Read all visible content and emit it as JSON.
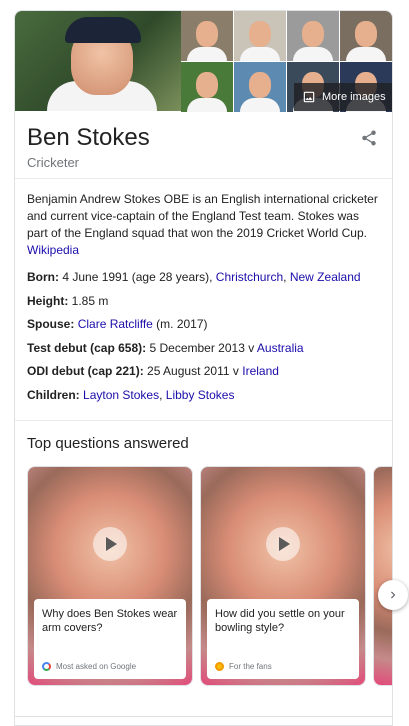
{
  "profile": {
    "name": "Ben Stokes",
    "subtitle": "Cricketer",
    "share_icon": "share-icon"
  },
  "images": {
    "more_label": "More images",
    "more_icon": "image-icon"
  },
  "about": {
    "description": "Benjamin Andrew Stokes OBE is an English international cricketer and current vice-captain of the England Test team. Stokes was part of the England squad that won the 2019 Cricket World Cup.",
    "source_link": "Wikipedia"
  },
  "facts": {
    "born": {
      "label": "Born:",
      "value": "4 June 1991 (age 28 years),",
      "link1": "Christchurch",
      "sep": ",",
      "link2": "New Zealand"
    },
    "height": {
      "label": "Height:",
      "value": "1.85 m"
    },
    "spouse": {
      "label": "Spouse:",
      "link": "Clare Ratcliffe",
      "value": "(m. 2017)"
    },
    "test_debut": {
      "label": "Test debut (cap 658):",
      "value": "5 December 2013 v",
      "link": "Australia"
    },
    "odi_debut": {
      "label": "ODI debut (cap 221):",
      "value": "25 August 2011 v",
      "link": "Ireland"
    },
    "children": {
      "label": "Children:",
      "link1": "Layton Stokes",
      "sep": ",",
      "link2": "Libby Stokes"
    }
  },
  "questions": {
    "heading": "Top questions answered",
    "items": [
      {
        "text": "Why does Ben Stokes wear arm covers?",
        "meta": "Most asked on Google"
      },
      {
        "text": "How did you settle on your bowling style?",
        "meta": "For the fans"
      }
    ],
    "next_icon": "chevron-right-icon"
  }
}
